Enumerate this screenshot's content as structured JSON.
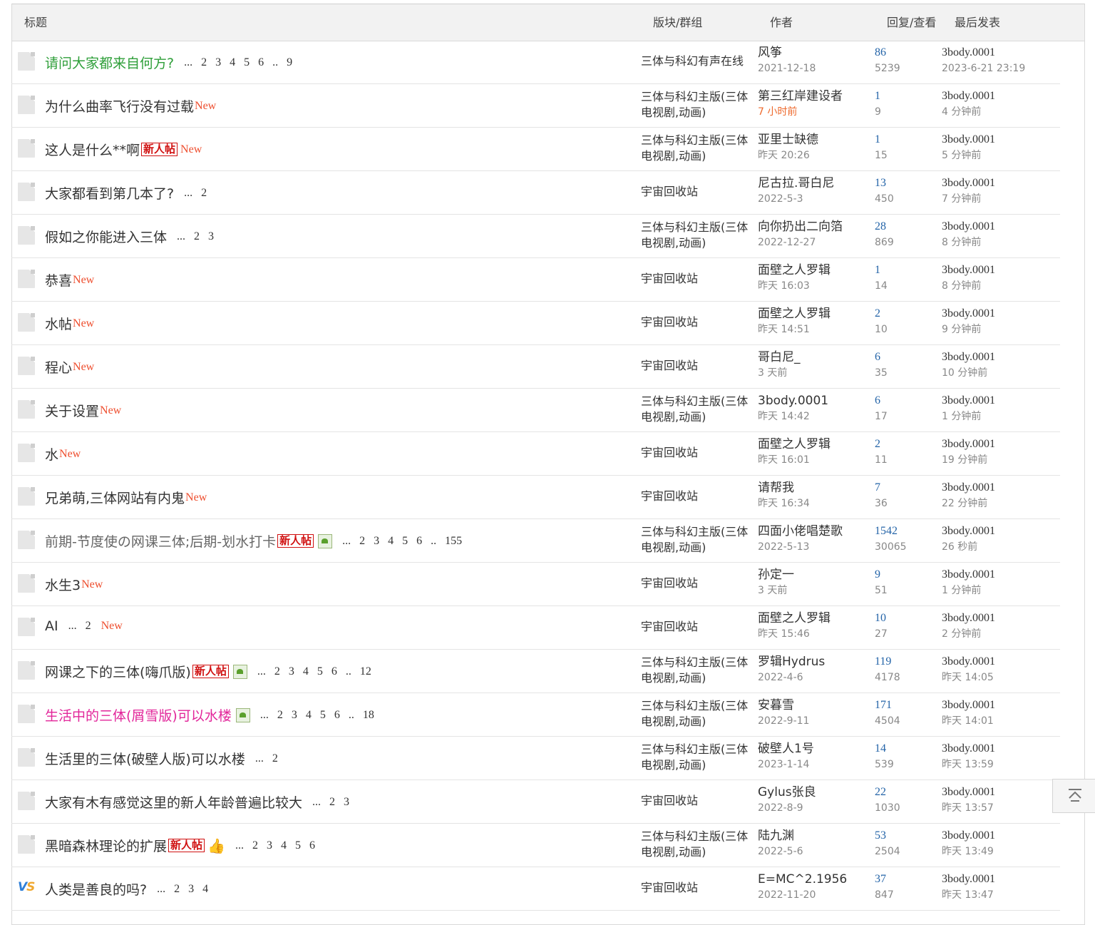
{
  "header": {
    "title": "标题",
    "forum": "版块/群组",
    "author": "作者",
    "stats": "回复/查看",
    "last": "最后发表"
  },
  "threads": [
    {
      "title": "请问大家都来自何方?",
      "style": "green",
      "new": "",
      "newbie": "",
      "img": false,
      "thumb": false,
      "pages": "... 2 3 4 5 6 .. 9",
      "forum": "三体与科幻有声在线",
      "author": "风筝",
      "date": "2021-12-18",
      "date_hot": false,
      "replies": "86",
      "views": "5239",
      "last_user": "3body.0001",
      "last_time": "2023-6-21 23:19",
      "icon": "doc"
    },
    {
      "title": "为什么曲率飞行没有过载",
      "style": "",
      "new": "New",
      "newbie": "",
      "img": false,
      "thumb": false,
      "pages": "",
      "forum": "三体与科幻主版(三体电视剧,动画)",
      "author": "第三红岸建设者",
      "date": "7 小时前",
      "date_hot": true,
      "replies": "1",
      "views": "9",
      "last_user": "3body.0001",
      "last_time": "4 分钟前",
      "icon": "doc"
    },
    {
      "title": "这人是什么**啊",
      "style": "",
      "new": "New",
      "newbie": "新人帖",
      "img": false,
      "thumb": false,
      "pages": "",
      "forum": "三体与科幻主版(三体电视剧,动画)",
      "author": "亚里士缺德",
      "date": "昨天 20:26",
      "date_hot": false,
      "replies": "1",
      "views": "15",
      "last_user": "3body.0001",
      "last_time": "5 分钟前",
      "icon": "doc"
    },
    {
      "title": "大家都看到第几本了?",
      "style": "",
      "new": "",
      "newbie": "",
      "img": false,
      "thumb": false,
      "pages": "... 2",
      "forum": "宇宙回收站",
      "author": "尼古拉.哥白尼",
      "date": "2022-5-3",
      "date_hot": false,
      "replies": "13",
      "views": "450",
      "last_user": "3body.0001",
      "last_time": "7 分钟前",
      "icon": "doc"
    },
    {
      "title": "假如之你能进入三体",
      "style": "",
      "new": "",
      "newbie": "",
      "img": false,
      "thumb": false,
      "pages": "... 2 3",
      "forum": "三体与科幻主版(三体电视剧,动画)",
      "author": "向你扔出二向箔",
      "date": "2022-12-27",
      "date_hot": false,
      "replies": "28",
      "views": "869",
      "last_user": "3body.0001",
      "last_time": "8 分钟前",
      "icon": "doc"
    },
    {
      "title": "恭喜",
      "style": "",
      "new": "New",
      "newbie": "",
      "img": false,
      "thumb": false,
      "pages": "",
      "forum": "宇宙回收站",
      "author": "面壁之人罗辑",
      "date": "昨天 16:03",
      "date_hot": false,
      "replies": "1",
      "views": "14",
      "last_user": "3body.0001",
      "last_time": "8 分钟前",
      "icon": "doc"
    },
    {
      "title": "水帖",
      "style": "",
      "new": "New",
      "newbie": "",
      "img": false,
      "thumb": false,
      "pages": "",
      "forum": "宇宙回收站",
      "author": "面壁之人罗辑",
      "date": "昨天 14:51",
      "date_hot": false,
      "replies": "2",
      "views": "10",
      "last_user": "3body.0001",
      "last_time": "9 分钟前",
      "icon": "doc"
    },
    {
      "title": "程心",
      "style": "",
      "new": "New",
      "newbie": "",
      "img": false,
      "thumb": false,
      "pages": "",
      "forum": "宇宙回收站",
      "author": "哥白尼_",
      "date": "3 天前",
      "date_hot": false,
      "replies": "6",
      "views": "35",
      "last_user": "3body.0001",
      "last_time": "10 分钟前",
      "icon": "doc"
    },
    {
      "title": "关于设置",
      "style": "",
      "new": "New",
      "newbie": "",
      "img": false,
      "thumb": false,
      "pages": "",
      "forum": "三体与科幻主版(三体电视剧,动画)",
      "author": "3body.0001",
      "date": "昨天 14:42",
      "date_hot": false,
      "replies": "6",
      "views": "17",
      "last_user": "3body.0001",
      "last_time": "1 分钟前",
      "icon": "doc"
    },
    {
      "title": "水",
      "style": "",
      "new": "New",
      "newbie": "",
      "img": false,
      "thumb": false,
      "pages": "",
      "forum": "宇宙回收站",
      "author": "面壁之人罗辑",
      "date": "昨天 16:01",
      "date_hot": false,
      "replies": "2",
      "views": "11",
      "last_user": "3body.0001",
      "last_time": "19 分钟前",
      "icon": "doc"
    },
    {
      "title": "兄弟萌,三体网站有内鬼",
      "style": "",
      "new": "New",
      "newbie": "",
      "img": false,
      "thumb": false,
      "pages": "",
      "forum": "宇宙回收站",
      "author": "请帮我",
      "date": "昨天 16:34",
      "date_hot": false,
      "replies": "7",
      "views": "36",
      "last_user": "3body.0001",
      "last_time": "22 分钟前",
      "icon": "doc"
    },
    {
      "title": "前期-节度使の网课三体;后期-划水打卡",
      "style": "grey",
      "new": "",
      "newbie": "新人帖",
      "img": true,
      "thumb": false,
      "pages": "... 2 3 4 5 6 .. 155",
      "forum": "三体与科幻主版(三体电视剧,动画)",
      "author": "四面小佬唱楚歌",
      "date": "2022-5-13",
      "date_hot": false,
      "replies": "1542",
      "views": "30065",
      "last_user": "3body.0001",
      "last_time": "26 秒前",
      "icon": "doc"
    },
    {
      "title": "水生3",
      "style": "",
      "new": "New",
      "newbie": "",
      "img": false,
      "thumb": false,
      "pages": "",
      "forum": "宇宙回收站",
      "author": "孙定一",
      "date": "3 天前",
      "date_hot": false,
      "replies": "9",
      "views": "51",
      "last_user": "3body.0001",
      "last_time": "1 分钟前",
      "icon": "doc"
    },
    {
      "title": "AI",
      "style": "",
      "new": "New",
      "newbie": "",
      "img": false,
      "thumb": false,
      "pages": "... 2",
      "forum": "宇宙回收站",
      "author": "面壁之人罗辑",
      "date": "昨天 15:46",
      "date_hot": false,
      "replies": "10",
      "views": "27",
      "last_user": "3body.0001",
      "last_time": "2 分钟前",
      "icon": "doc",
      "new_after_pages": true
    },
    {
      "title": "网课之下的三体(嗨爪版)",
      "style": "",
      "new": "",
      "newbie": "新人帖",
      "img": true,
      "thumb": false,
      "pages": "... 2 3 4 5 6 .. 12",
      "forum": "三体与科幻主版(三体电视剧,动画)",
      "author": "罗辑Hydrus",
      "date": "2022-4-6",
      "date_hot": false,
      "replies": "119",
      "views": "4178",
      "last_user": "3body.0001",
      "last_time": "昨天 14:05",
      "icon": "doc"
    },
    {
      "title": "生活中的三体(屑雪版)可以水楼",
      "style": "pink",
      "new": "",
      "newbie": "",
      "img": true,
      "thumb": false,
      "pages": "... 2 3 4 5 6 .. 18",
      "forum": "三体与科幻主版(三体电视剧,动画)",
      "author": "安暮雪",
      "date": "2022-9-11",
      "date_hot": false,
      "replies": "171",
      "views": "4504",
      "last_user": "3body.0001",
      "last_time": "昨天 14:01",
      "icon": "doc"
    },
    {
      "title": "生活里的三体(破壁人版)可以水楼",
      "style": "",
      "new": "",
      "newbie": "",
      "img": false,
      "thumb": false,
      "pages": "... 2",
      "forum": "三体与科幻主版(三体电视剧,动画)",
      "author": "破壁人1号",
      "date": "2023-1-14",
      "date_hot": false,
      "replies": "14",
      "views": "539",
      "last_user": "3body.0001",
      "last_time": "昨天 13:59",
      "icon": "doc"
    },
    {
      "title": "大家有木有感觉这里的新人年龄普遍比较大",
      "style": "",
      "new": "",
      "newbie": "",
      "img": false,
      "thumb": false,
      "pages": "... 2 3",
      "forum": "宇宙回收站",
      "author": "Gylus张良",
      "date": "2022-8-9",
      "date_hot": false,
      "replies": "22",
      "views": "1030",
      "last_user": "3body.0001",
      "last_time": "昨天 13:57",
      "icon": "doc"
    },
    {
      "title": "黑暗森林理论的扩展",
      "style": "",
      "new": "",
      "newbie": "新人帖",
      "img": false,
      "thumb": true,
      "pages": "... 2 3 4 5 6",
      "forum": "三体与科幻主版(三体电视剧,动画)",
      "author": "陆九渊",
      "date": "2022-5-6",
      "date_hot": false,
      "replies": "53",
      "views": "2504",
      "last_user": "3body.0001",
      "last_time": "昨天 13:49",
      "icon": "doc"
    },
    {
      "title": "人类是善良的吗?",
      "style": "",
      "new": "",
      "newbie": "",
      "img": false,
      "thumb": false,
      "pages": "... 2 3 4",
      "forum": "宇宙回收站",
      "author": "E=MC^2.1956",
      "date": "2022-11-20",
      "date_hot": false,
      "replies": "37",
      "views": "847",
      "last_user": "3body.0001",
      "last_time": "昨天 13:47",
      "icon": "vs"
    }
  ],
  "vs_icon": {
    "v": "V",
    "s": "S"
  },
  "icons": {
    "thread": "document-icon",
    "debate": "vs-icon",
    "image": "image-attachment-icon",
    "thumb": "thumbs-up-icon",
    "top": "back-to-top-icon"
  },
  "colors": {
    "new": "#ee4d2d",
    "link": "#2464a8",
    "green": "#2f9f3a",
    "pink": "#e2269a",
    "hot": "#ee6a2d"
  }
}
